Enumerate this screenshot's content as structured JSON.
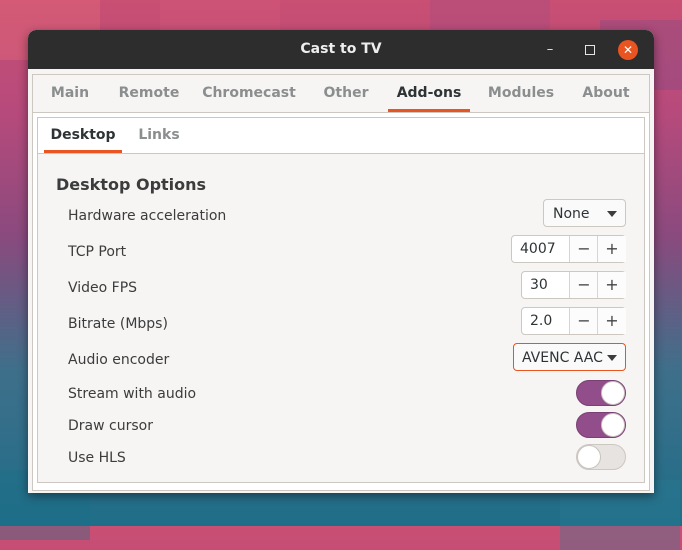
{
  "window": {
    "title": "Cast to TV"
  },
  "titlebar": {
    "minimize_icon": "minimize-icon",
    "maximize_icon": "maximize-icon",
    "close_icon": "close-icon"
  },
  "tabs": [
    {
      "label": "Main"
    },
    {
      "label": "Remote"
    },
    {
      "label": "Chromecast"
    },
    {
      "label": "Other"
    },
    {
      "label": "Add-ons",
      "active": true
    },
    {
      "label": "Modules"
    },
    {
      "label": "About"
    }
  ],
  "subtabs": [
    {
      "label": "Desktop",
      "active": true
    },
    {
      "label": "Links"
    }
  ],
  "section": {
    "title": "Desktop Options",
    "hardware_acceleration": {
      "label": "Hardware acceleration",
      "value": "None"
    },
    "tcp_port": {
      "label": "TCP Port",
      "value": "4007"
    },
    "video_fps": {
      "label": "Video FPS",
      "value": "30"
    },
    "bitrate": {
      "label": "Bitrate (Mbps)",
      "value": "2.0"
    },
    "audio_encoder": {
      "label": "Audio encoder",
      "value": "AVENC AAC"
    },
    "stream_with_audio": {
      "label": "Stream with audio",
      "on": true
    },
    "draw_cursor": {
      "label": "Draw cursor",
      "on": true
    },
    "use_hls": {
      "label": "Use HLS",
      "on": false
    }
  },
  "spin_symbols": {
    "minus": "−",
    "plus": "+"
  },
  "colors": {
    "accent": "#e95420",
    "switch_on": "#924d8b",
    "titlebar": "#2d2d2d"
  }
}
